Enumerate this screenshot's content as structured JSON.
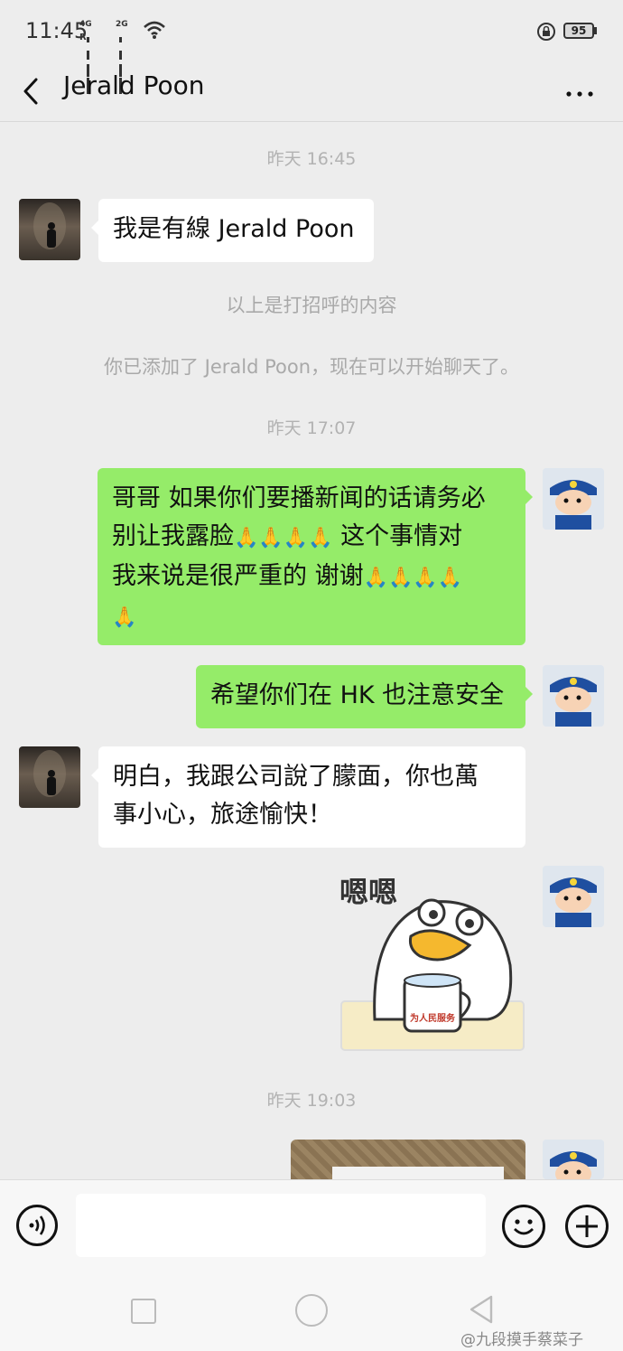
{
  "status_bar": {
    "time": "11:45",
    "signal1_label": "4G",
    "signal2_label": "2G",
    "battery": "95"
  },
  "header": {
    "title": "Jerald Poon"
  },
  "chat": {
    "timestamp1": "昨天 16:45",
    "msg1": "我是有線 Jerald Poon",
    "sys1": "以上是打招呼的内容",
    "sys2": "你已添加了 Jerald Poon，现在可以开始聊天了。",
    "timestamp2": "昨天 17:07",
    "msg2_line1": "哥哥 如果你们要播新闻的话请务必",
    "msg2_line2a": "别让我露脸",
    "msg2_line2b": "这个事情对",
    "msg2_line3a": "我来说是很严重的 谢谢",
    "msg3": "希望你们在 HK 也注意安全",
    "msg4_line1": "明白，我跟公司說了朦面，你也萬",
    "msg4_line2": "事小心，旅途愉快！",
    "sticker_text": "嗯嗯",
    "sticker_mug_text": "为人民服务",
    "timestamp3": "昨天 19:03",
    "pray_emoji": "🙏🙏🙏🙏"
  },
  "watermark": "@九段摸手蔡菜子",
  "colors": {
    "bg": "#ededed",
    "bubble_out": "#95ec69",
    "bubble_in": "#ffffff"
  }
}
